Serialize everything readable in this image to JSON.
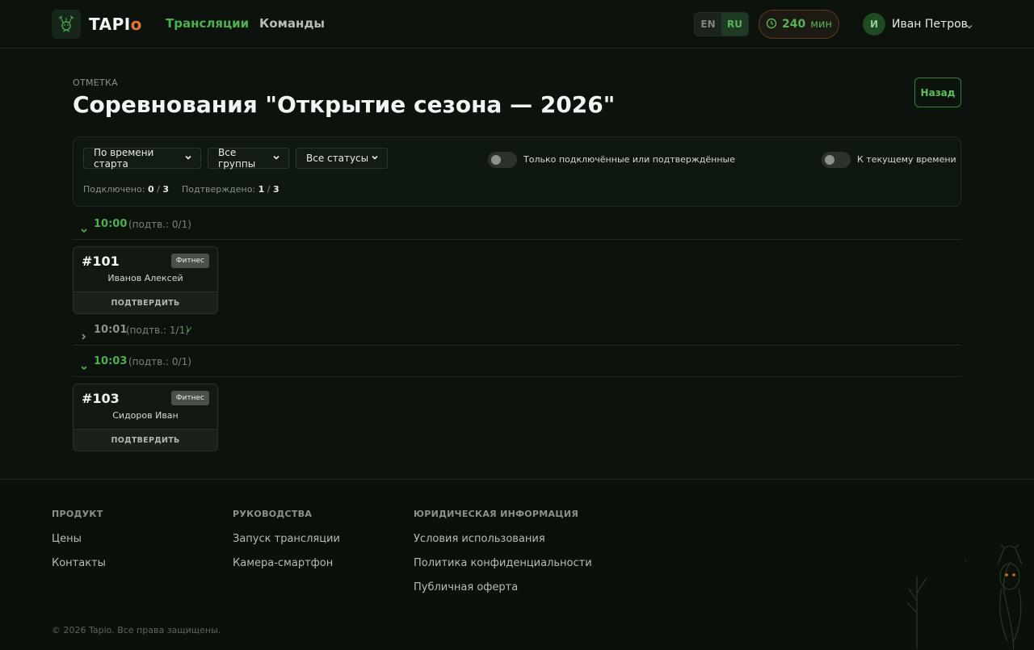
{
  "header": {
    "logo_main": "TAPI",
    "logo_accent": "o",
    "nav": [
      {
        "label": "Трансляции",
        "active": true
      },
      {
        "label": "Команды",
        "active": false
      }
    ],
    "lang": {
      "options": [
        "EN",
        "RU"
      ],
      "selected": "RU"
    },
    "minutes": {
      "value": "240",
      "unit": "мин"
    },
    "user": {
      "initial": "И",
      "name": "Иван Петров"
    }
  },
  "page": {
    "eyebrow": "ОТМЕТКА",
    "title": "Соревнования \"Открытие сезона — 2026\"",
    "back_label": "Назад"
  },
  "filters": {
    "sort": "По времени старта",
    "group": "Все группы",
    "status": "Все статусы",
    "toggle_connected_label": "Только подключённые или подтверждённые",
    "toggle_now_label": "К текущему времени",
    "connected_label": "Подключено:",
    "connected_value": "0",
    "connected_total": "3",
    "confirmed_label": "Подтверждено:",
    "confirmed_value": "1",
    "confirmed_total": "3",
    "sep": "/"
  },
  "slots": [
    {
      "time": "10:00",
      "summary": "(подтв.: 0/1)",
      "expanded": true,
      "done": false
    },
    {
      "time": "10:01",
      "summary": "(подтв.: 1/1)",
      "expanded": false,
      "done": true,
      "check": "✓"
    },
    {
      "time": "10:03",
      "summary": "(подтв.: 0/1)",
      "expanded": true,
      "done": false
    }
  ],
  "cards": [
    {
      "num": "#101",
      "badge": "Фитнес",
      "name": "Иванов Алексей",
      "action": "ПОДТВЕРДИТЬ"
    },
    {
      "num": "#103",
      "badge": "Фитнес",
      "name": "Сидоров Иван",
      "action": "ПОДТВЕРДИТЬ"
    }
  ],
  "footer": {
    "columns": [
      {
        "head": "ПРОДУКТ",
        "links": [
          "Цены",
          "Контакты"
        ]
      },
      {
        "head": "РУКОВОДСТВА",
        "links": [
          "Запуск трансляции",
          "Камера-смартфон"
        ]
      },
      {
        "head": "ЮРИДИЧЕСКАЯ ИНФОРМАЦИЯ",
        "links": [
          "Условия использования",
          "Политика конфиденциальности",
          "Публичная оферта"
        ]
      }
    ],
    "copyright": "© 2026 Tapio. Все права защищены."
  },
  "colors": {
    "accent": "#4fae4f",
    "logo_accent": "#e0752f",
    "background": "#0b130c"
  }
}
